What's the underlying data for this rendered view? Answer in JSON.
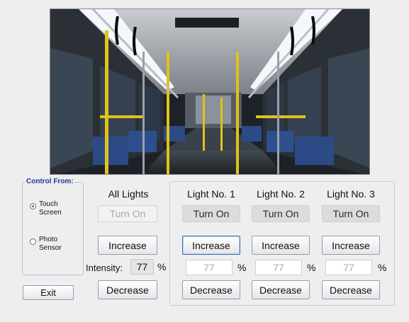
{
  "control_from": {
    "legend": "Control From:",
    "options": [
      {
        "label_line1": "Touch",
        "label_line2": "Screen",
        "selected": true
      },
      {
        "label_line1": "Photo",
        "label_line2": "Sensor",
        "selected": false
      }
    ]
  },
  "exit_label": "Exit",
  "all_lights": {
    "title": "All Lights",
    "turn_on_label": "Turn On",
    "increase_label": "Increase",
    "intensity_label": "Intensity:",
    "intensity_value": "77",
    "percent": "%",
    "decrease_label": "Decrease"
  },
  "lights": [
    {
      "title": "Light No. 1",
      "turn_on_label": "Turn On",
      "increase_label": "Increase",
      "intensity_value": "77",
      "percent": "%",
      "decrease_label": "Decrease"
    },
    {
      "title": "Light No. 2",
      "turn_on_label": "Turn On",
      "increase_label": "Increase",
      "intensity_value": "77",
      "percent": "%",
      "decrease_label": "Decrease"
    },
    {
      "title": "Light No. 3",
      "turn_on_label": "Turn On",
      "increase_label": "Increase",
      "intensity_value": "77",
      "percent": "%",
      "decrease_label": "Decrease"
    }
  ],
  "colors": {
    "legend_text": "#1f3a93",
    "pole_yellow": "#e2c21a",
    "seat_blue": "#2b4a86"
  }
}
